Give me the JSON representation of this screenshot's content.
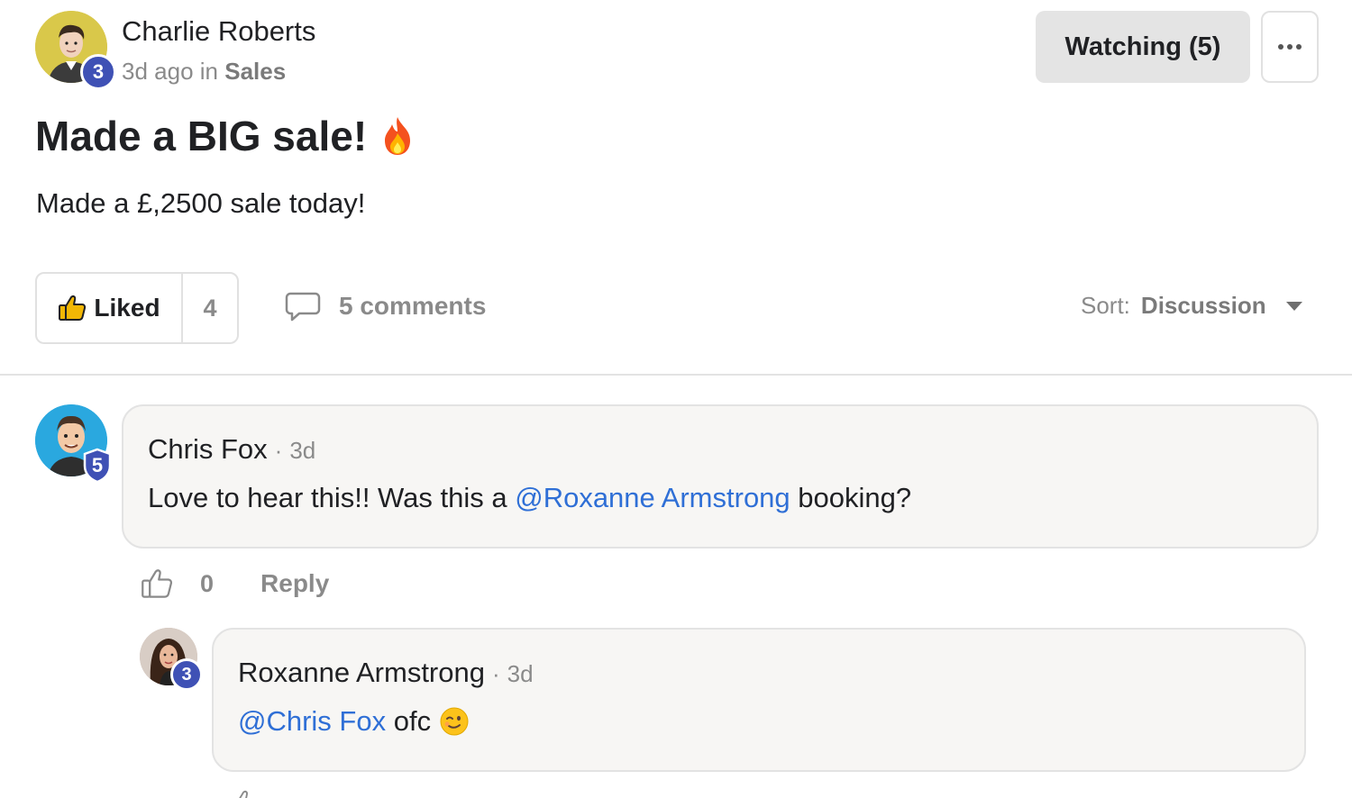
{
  "post": {
    "author": "Charlie Roberts",
    "author_level": "3",
    "time_ago": "3d ago",
    "in_word": "in",
    "category": "Sales",
    "title": "Made a BIG sale!",
    "title_emoji": "fire-emoji",
    "body": "Made a £,2500 sale today!"
  },
  "header": {
    "watching_label": "Watching (5)",
    "more_icon": "more-dots-icon"
  },
  "actions": {
    "liked_label": "Liked",
    "like_count": "4",
    "comments_label": "5 comments",
    "sort_prefix": "Sort:",
    "sort_value": "Discussion"
  },
  "comments": [
    {
      "author": "Chris Fox",
      "author_level": "5",
      "time": "3d",
      "text_before": "Love to hear this!! Was this a ",
      "mention": "@Roxanne Armstrong",
      "text_after": " booking?",
      "likes": "0",
      "reply_label": "Reply"
    },
    {
      "author": "Roxanne Armstrong",
      "author_level": "3",
      "time": "3d",
      "mention": "@Chris Fox",
      "text_after": " ofc",
      "emoji": "wink-emoji"
    }
  ],
  "colors": {
    "badge": "#3f51b5",
    "mention": "#2f6fd6",
    "muted": "#8a8a8a",
    "bubble": "#f7f6f4"
  }
}
